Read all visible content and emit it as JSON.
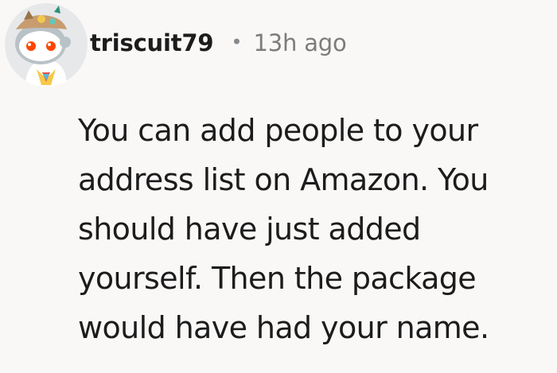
{
  "comment": {
    "author": "triscuit79",
    "separator": "•",
    "timestamp": "13h ago",
    "body_lines": [
      "You can add people to your",
      "address list on Amazon. You",
      "should have just added",
      "yourself. Then the package",
      "would have had your name."
    ]
  },
  "avatar": {
    "icon": "snoo-avatar-icon",
    "bg_color": "#e6e8ea"
  }
}
